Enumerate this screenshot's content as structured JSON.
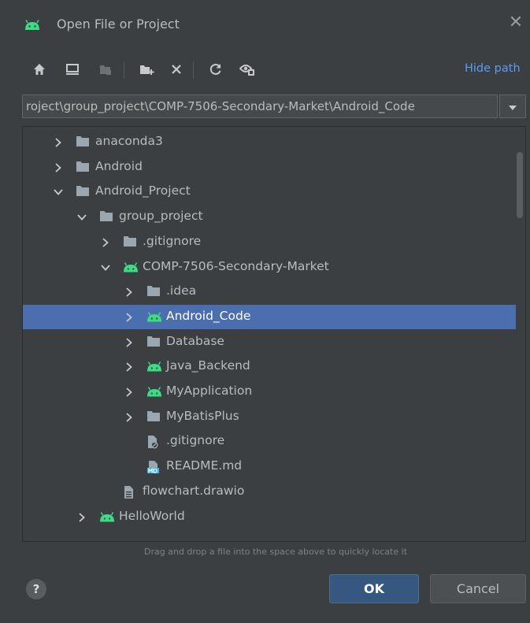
{
  "dialog": {
    "title": "Open File or Project",
    "close_glyph": "✕"
  },
  "toolbar": {
    "buttons": [
      {
        "name": "home-icon"
      },
      {
        "name": "desktop-icon"
      },
      {
        "name": "project-dir-icon"
      },
      {
        "name": "new-folder-icon"
      },
      {
        "name": "delete-icon"
      },
      {
        "name": "refresh-icon"
      },
      {
        "name": "show-hidden-icon"
      }
    ],
    "hide_path_label": "Hide path"
  },
  "path": {
    "value": "roject\\group_project\\COMP-7506-Secondary-Market\\Android_Code"
  },
  "tree": {
    "rows": [
      {
        "label": "anaconda3",
        "icon": "folder",
        "chevron": "right"
      },
      {
        "label": "Android",
        "icon": "folder",
        "chevron": "right"
      },
      {
        "label": "Android_Project",
        "icon": "folder",
        "chevron": "down"
      },
      {
        "label": "group_project",
        "icon": "folder",
        "chevron": "down"
      },
      {
        "label": ".gitignore",
        "icon": "folder",
        "chevron": "right"
      },
      {
        "label": "COMP-7506-Secondary-Market",
        "icon": "android",
        "chevron": "down"
      },
      {
        "label": ".idea",
        "icon": "folder",
        "chevron": "right"
      },
      {
        "label": "Android_Code",
        "icon": "android",
        "chevron": "right",
        "selected": true
      },
      {
        "label": "Database",
        "icon": "folder",
        "chevron": "right"
      },
      {
        "label": "Java_Backend",
        "icon": "android",
        "chevron": "right"
      },
      {
        "label": "MyApplication",
        "icon": "android",
        "chevron": "right"
      },
      {
        "label": "MyBatisPlus",
        "icon": "folder",
        "chevron": "right"
      },
      {
        "label": ".gitignore",
        "icon": "ignore-file",
        "chevron": "none"
      },
      {
        "label": "README.md",
        "icon": "markdown-file",
        "chevron": "none"
      },
      {
        "label": "flowchart.drawio",
        "icon": "text-file",
        "chevron": "none"
      },
      {
        "label": "HelloWorld",
        "icon": "android",
        "chevron": "right"
      }
    ]
  },
  "hint": "Drag and drop a file into the space above to quickly locate it",
  "buttons": {
    "help": "?",
    "ok": "OK",
    "cancel": "Cancel"
  },
  "colors": {
    "background": "#3c3f41",
    "selection": "#4b6eaf",
    "accent_link": "#589df6",
    "android_green": "#3ddc84"
  }
}
